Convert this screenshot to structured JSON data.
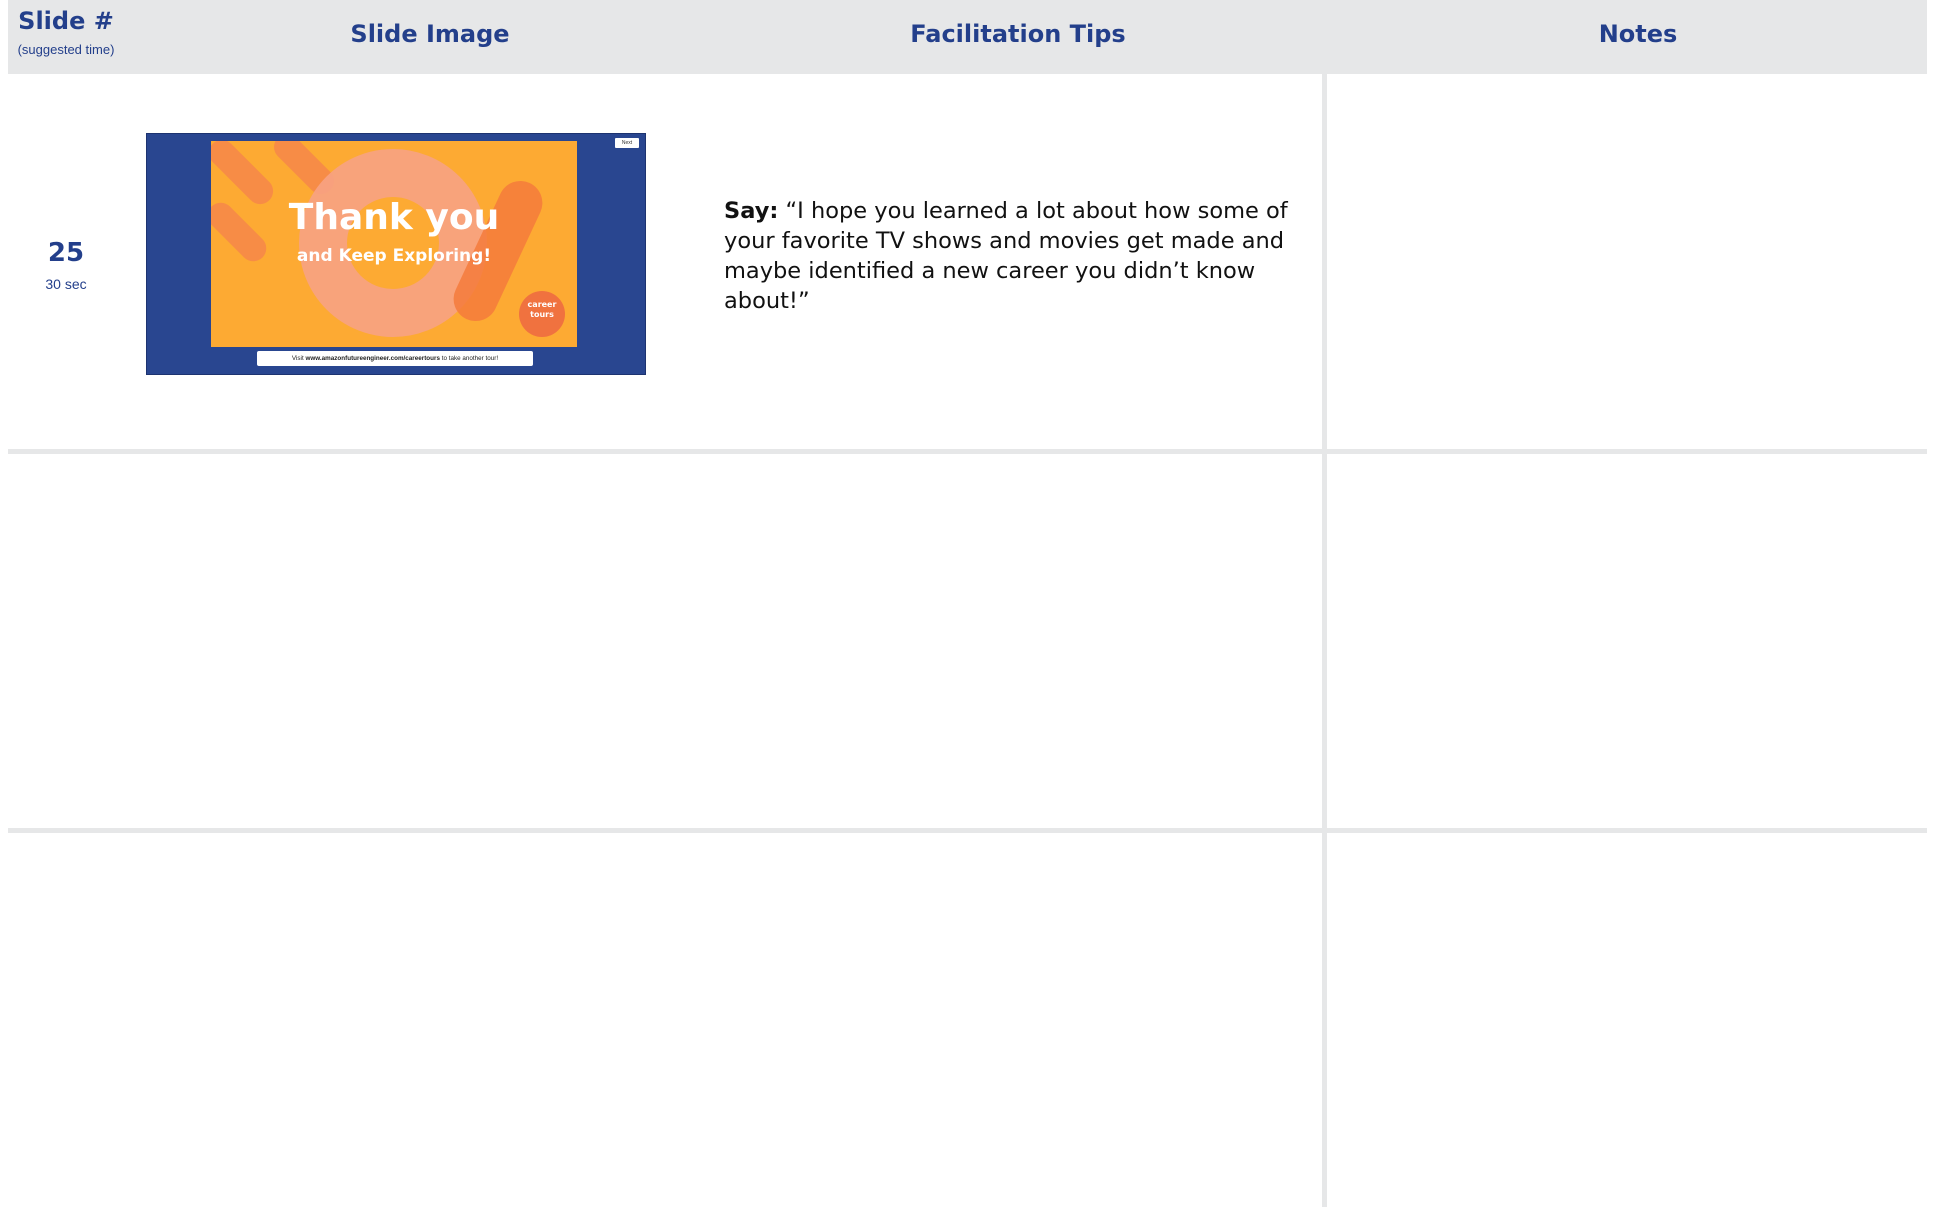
{
  "header": {
    "slide_num_label": "Slide #",
    "slide_num_sub": "(suggested time)",
    "slide_image_label": "Slide Image",
    "facilitation_tips_label": "Facilitation Tips",
    "notes_label": "Notes"
  },
  "rows": [
    {
      "slide_number": "25",
      "time": "30 sec",
      "thumbnail": {
        "title": "Thank you",
        "subtitle": "and Keep Exploring!",
        "badge": "career tours",
        "next_button": "Next",
        "visit_prefix": "Visit ",
        "visit_url": "www.amazonfutureengineer.com/careertours",
        "visit_suffix": " to take another tour!"
      },
      "tip_label": "Say:",
      "tip_text": " “I hope you learned a lot about how some of your favorite TV shows and movies get made and maybe identified a new career you didn’t know about!”",
      "notes": ""
    }
  ],
  "colors": {
    "header_bg": "#e6e7e8",
    "header_text": "#233f8b",
    "slide_bg": "#294690",
    "slide_panel": "#fdaa33",
    "divider": "#e6e7e8"
  }
}
